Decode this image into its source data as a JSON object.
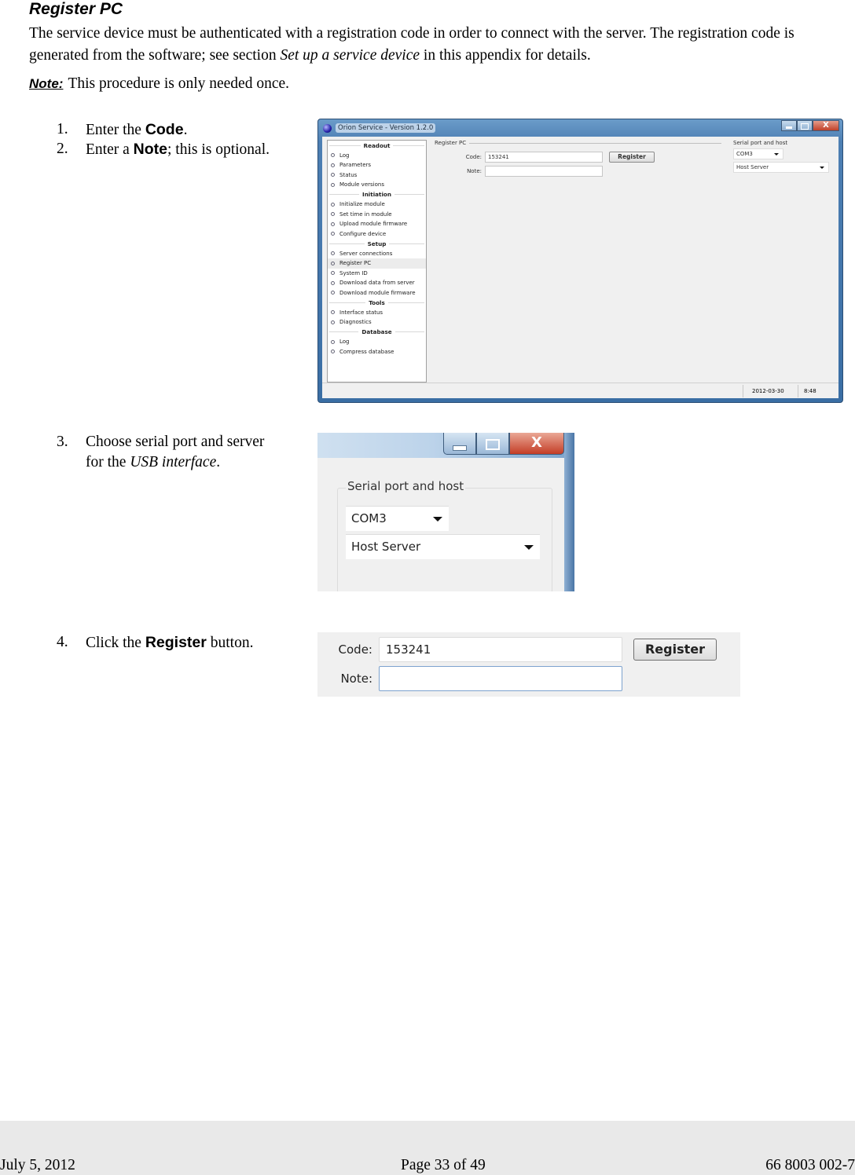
{
  "document": {
    "heading": "Register PC",
    "intro": {
      "part1": "The service device must be authenticated with a registration code in order to connect with the server. The registration code is generated from the software; see section ",
      "link_text": "Set up a service device",
      "part2": " in this appendix for details."
    },
    "note": {
      "label": "Note:",
      "text": "This procedure is only needed once."
    },
    "steps": [
      {
        "num": "1.",
        "pre": "Enter the ",
        "bold": "Code",
        "post": "."
      },
      {
        "num": "2.",
        "pre": "Enter a ",
        "bold": "Note",
        "post": "; this is optional."
      },
      {
        "num": "3.",
        "pre": "Choose serial port and server",
        "line2_pre": "for the ",
        "italic": "USB interface",
        "post": "."
      },
      {
        "num": "4.",
        "pre": "Click the ",
        "bold": "Register",
        "post": " button."
      }
    ]
  },
  "app_window": {
    "title": "Orion Service - Version 1.2.0",
    "controls": {
      "minimize": "minimize",
      "maximize": "maximize",
      "close": "X"
    },
    "nav": [
      {
        "section": "Readout",
        "items": [
          "Log",
          "Parameters",
          "Status",
          "Module versions"
        ]
      },
      {
        "section": "Initiation",
        "items": [
          "Initialize module",
          "Set time in module",
          "Upload module firmware",
          "Configure device"
        ]
      },
      {
        "section": "Setup",
        "items": [
          "Server connections",
          "Register PC",
          "System ID",
          "Download data from server",
          "Download module firmware"
        ]
      },
      {
        "section": "Tools",
        "items": [
          "Interface status",
          "Diagnostics"
        ]
      },
      {
        "section": "Database",
        "items": [
          "Log",
          "Compress database"
        ]
      }
    ],
    "selected_nav_item": "Register PC",
    "register_group": {
      "legend": "Register PC",
      "code_label": "Code:",
      "code_value": "153241",
      "note_label": "Note:",
      "note_value": "",
      "register_button": "Register"
    },
    "serial_group": {
      "legend": "Serial port and host",
      "port_value": "COM3",
      "host_value": "Host Server"
    },
    "status_bar": {
      "date": "2012-03-30",
      "time": "8:48"
    }
  },
  "footer": {
    "date": "July 5, 2012",
    "page": "Page 33 of 49",
    "doc_number": "66 8003 002-7"
  }
}
